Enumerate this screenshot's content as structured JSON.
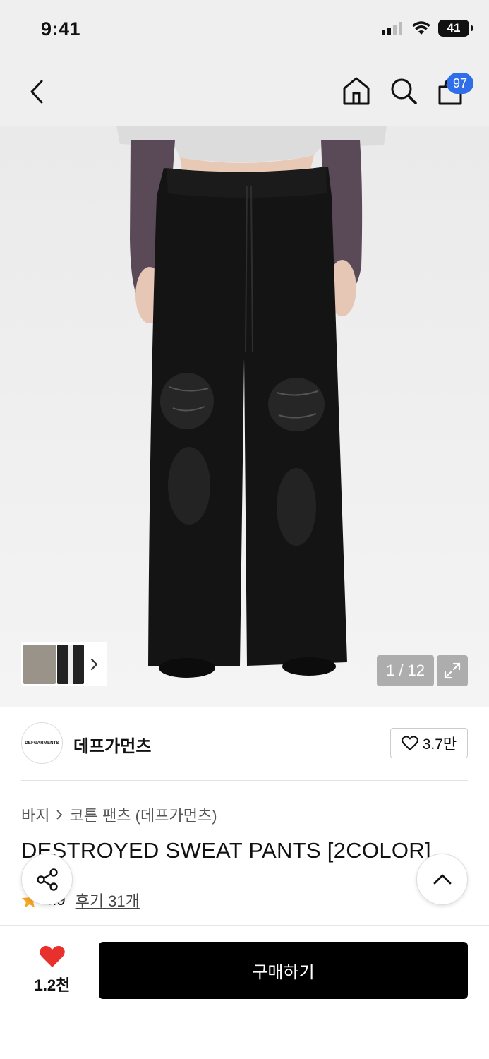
{
  "status_bar": {
    "time": "9:41",
    "battery": "41"
  },
  "nav": {
    "cart_count": "97"
  },
  "gallery": {
    "counter": "1 / 12"
  },
  "brand": {
    "logo_text": "DEFGARMENTS",
    "name": "데프가먼츠",
    "likes": "3.7만"
  },
  "breadcrumb": {
    "category": "바지",
    "subcategory": "코튼 팬츠 (데프가먼츠)"
  },
  "product": {
    "title": "DESTROYED SWEAT PANTS [2COLOR]",
    "rating": "4.9",
    "reviews": "후기 31개"
  },
  "bottom": {
    "like_count": "1.2천",
    "buy_label": "구매하기"
  },
  "colors": {
    "cart_badge": "#2f6ee8",
    "heart": "#e8302d",
    "star": "#f5a623",
    "buy_button": "#000000"
  }
}
